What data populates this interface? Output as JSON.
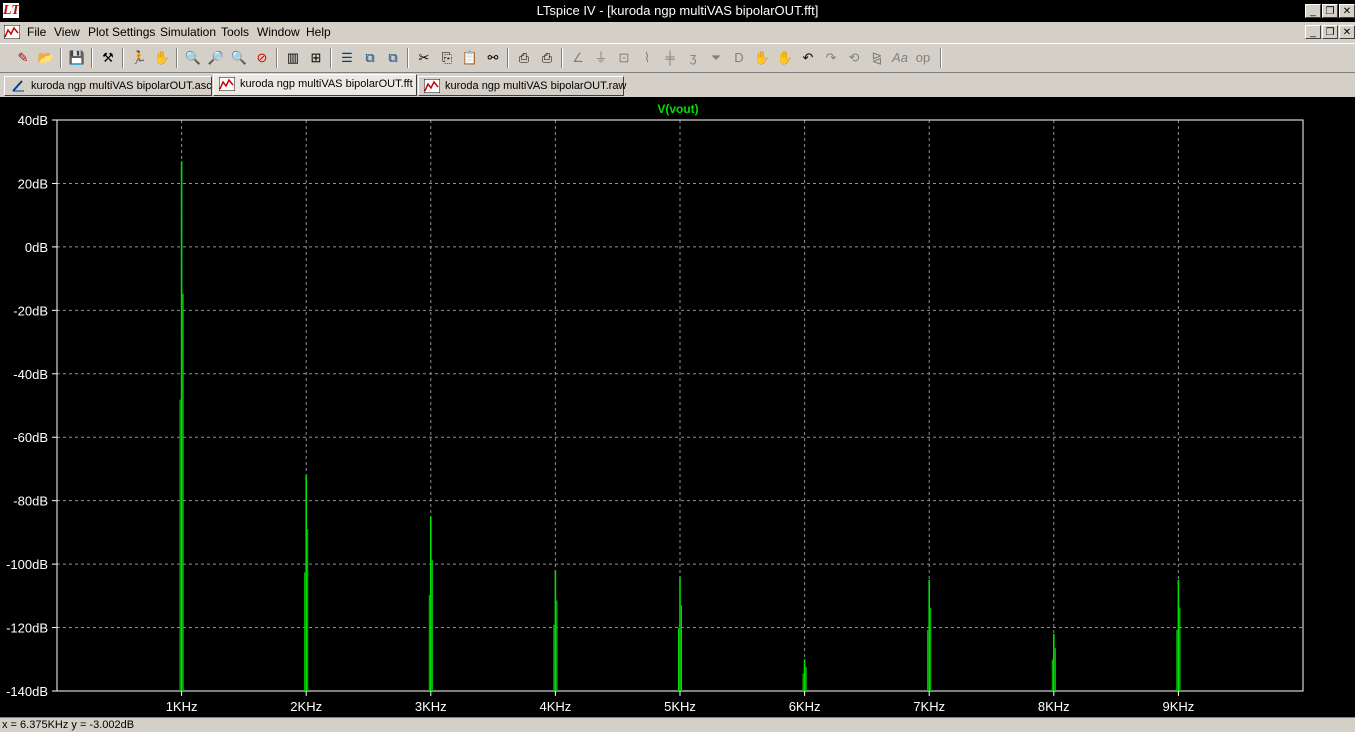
{
  "window": {
    "title": "LTspice IV - [kuroda ngp multiVAS bipolarOUT.fft]",
    "app_icon_glyph": "LT"
  },
  "menu": [
    "File",
    "View",
    "Plot Settings",
    "Simulation",
    "Tools",
    "Window",
    "Help"
  ],
  "tabs": [
    {
      "label": "kuroda ngp multiVAS bipolarOUT.asc",
      "icon": "schematic-icon"
    },
    {
      "label": "kuroda ngp multiVAS bipolarOUT.fft",
      "icon": "waveform-icon"
    },
    {
      "label": "kuroda ngp multiVAS bipolarOUT.raw",
      "icon": "waveform-icon"
    }
  ],
  "status": {
    "text": "x = 6.375KHz   y = -3.002dB"
  },
  "chart_data": {
    "type": "line",
    "title": "V(vout)",
    "series": [
      {
        "name": "V(vout)",
        "color": "#00e000"
      }
    ],
    "yticks": [
      "40dB",
      "20dB",
      "0dB",
      "-20dB",
      "-40dB",
      "-60dB",
      "-80dB",
      "-100dB",
      "-120dB",
      "-140dB"
    ],
    "xticks": [
      "1KHz",
      "2KHz",
      "3KHz",
      "4KHz",
      "5KHz",
      "6KHz",
      "7KHz",
      "8KHz",
      "9KHz"
    ],
    "xlim": [
      0,
      10.0
    ],
    "ylim": [
      -140,
      40
    ],
    "grid": true,
    "peaks": [
      {
        "f": 1,
        "db": 27
      },
      {
        "f": 2,
        "db": -72
      },
      {
        "f": 3,
        "db": -85
      },
      {
        "f": 4,
        "db": -102
      },
      {
        "f": 5,
        "db": -104
      },
      {
        "f": 6,
        "db": -130
      },
      {
        "f": 7,
        "db": -105
      },
      {
        "f": 8,
        "db": -122
      },
      {
        "f": 9,
        "db": -105
      }
    ],
    "colors": {
      "background": "#000000",
      "grid": "#909090",
      "axis": "#ffffff",
      "trace": "#00e000"
    }
  }
}
